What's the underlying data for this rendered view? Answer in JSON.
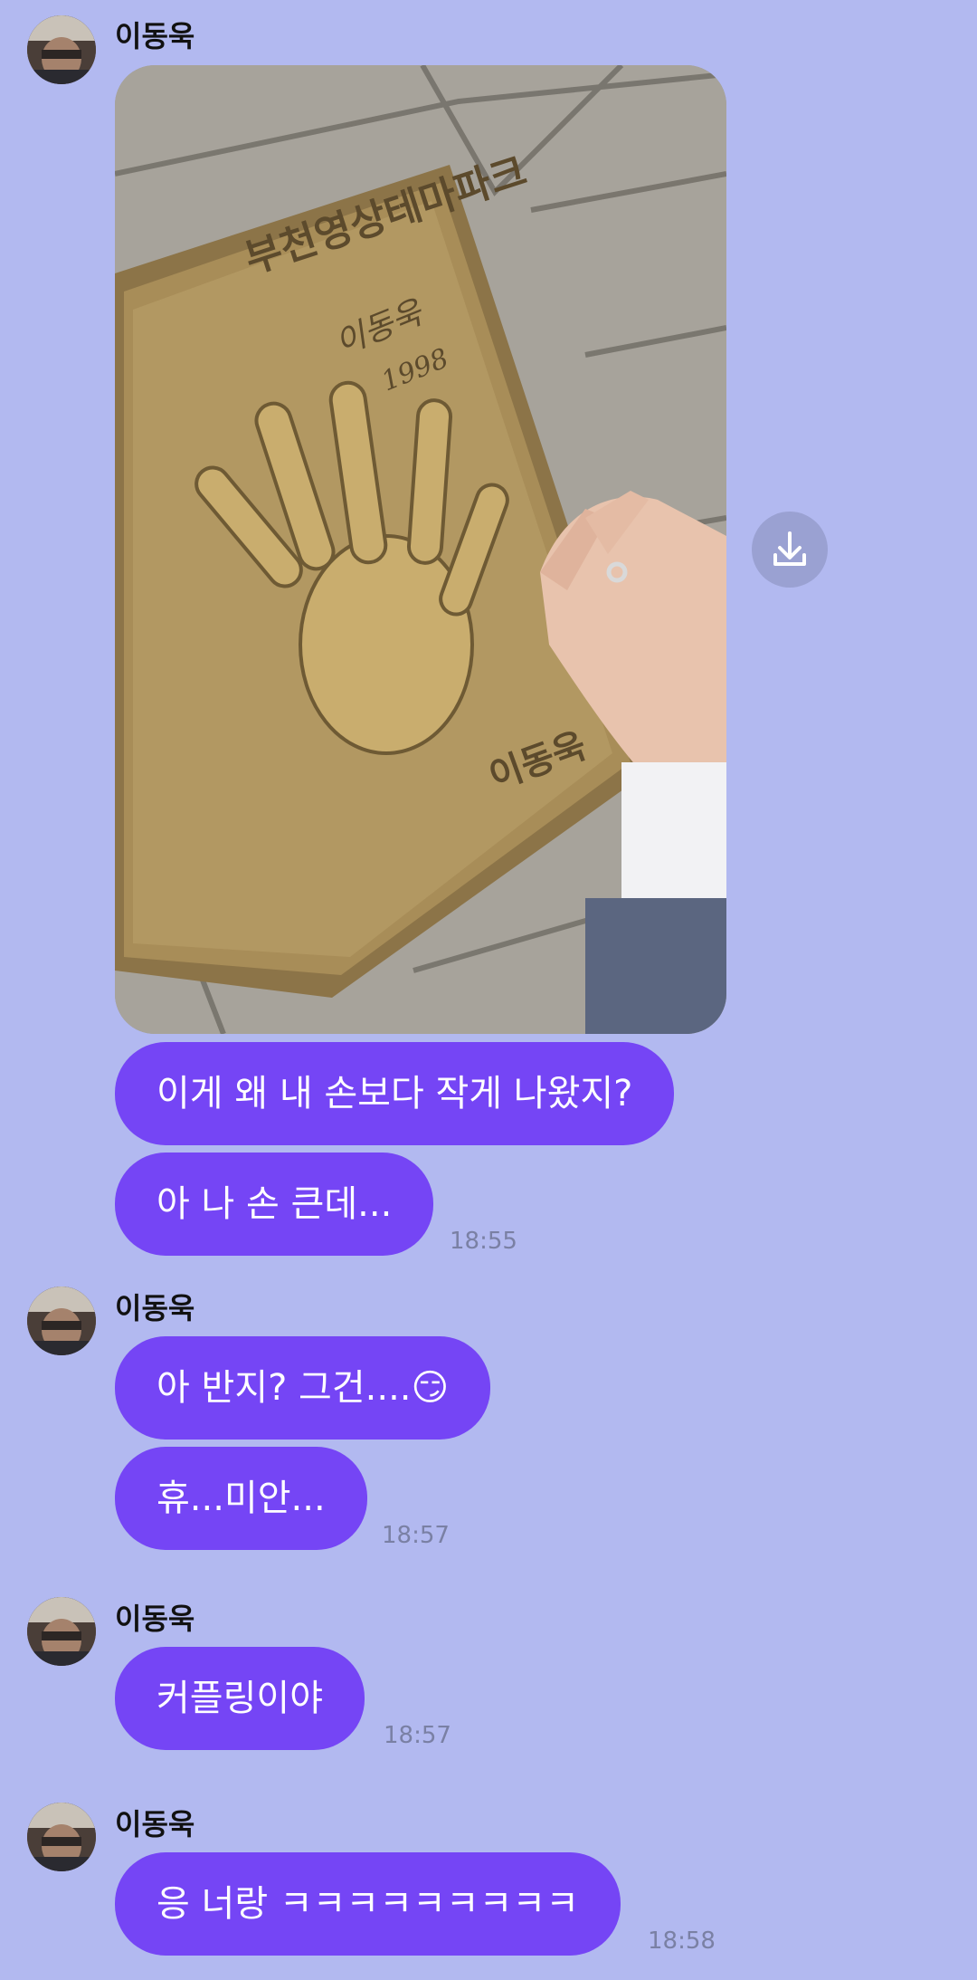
{
  "messages": [
    {
      "sender": "이동욱",
      "image": {
        "plaque_title": "부천영상테마파크",
        "signature": "이동욱",
        "year": "1998",
        "name_engraving": "이동욱"
      },
      "download_icon": "download-icon",
      "bubbles": [
        "이게 왜 내 손보다 작게 나왔지?",
        "아 나 손 큰데..."
      ],
      "time": "18:55"
    },
    {
      "sender": "이동욱",
      "bubbles": [
        "아 반지? 그건....😏",
        "휴...미안..."
      ],
      "time": "18:57"
    },
    {
      "sender": "이동욱",
      "bubbles": [
        "커플링이야"
      ],
      "time": "18:57"
    },
    {
      "sender": "이동욱",
      "bubbles": [
        "응 너랑 ㅋㅋㅋㅋㅋㅋㅋㅋㅋ"
      ],
      "time": "18:58"
    }
  ],
  "colors": {
    "background": "#b2b9f0",
    "bubble": "#7545f5",
    "bubble_text": "#ffffff",
    "timestamp": "#7a80a4",
    "name": "#111111"
  }
}
